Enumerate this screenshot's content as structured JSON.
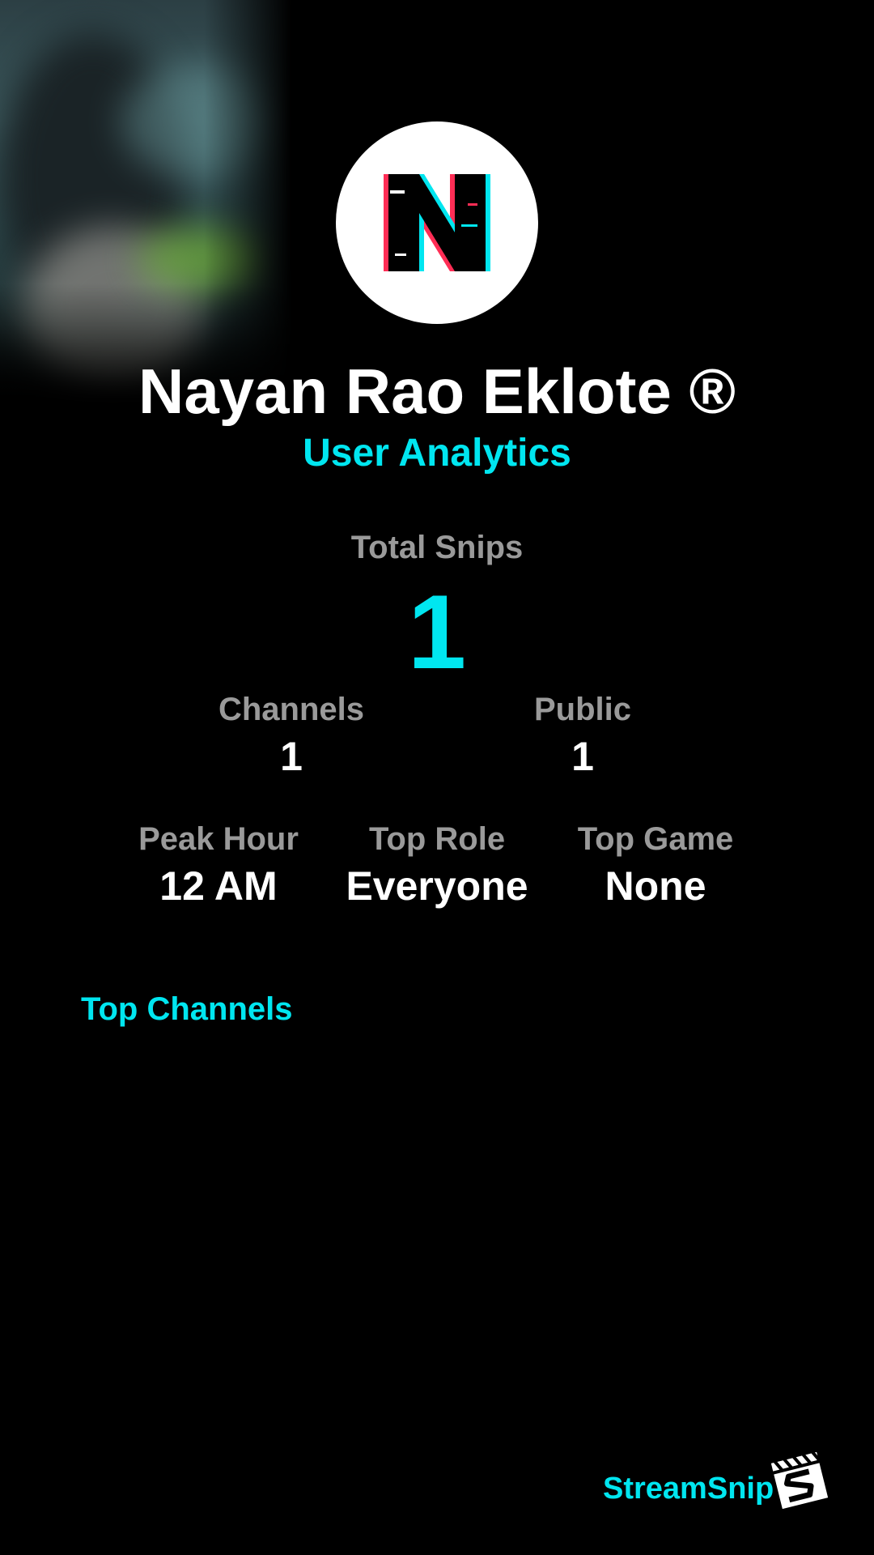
{
  "profile": {
    "name": "Nayan Rao Eklote ®",
    "subtitle": "User Analytics",
    "avatar_icon": "glitch-letter-n-logo"
  },
  "stats": {
    "total_snips": {
      "label": "Total Snips",
      "value": "1"
    },
    "channels": {
      "label": "Channels",
      "value": "1"
    },
    "public": {
      "label": "Public",
      "value": "1"
    },
    "peak_hour": {
      "label": "Peak Hour",
      "value": "12 AM"
    },
    "top_role": {
      "label": "Top Role",
      "value": "Everyone"
    },
    "top_game": {
      "label": "Top Game",
      "value": "None"
    }
  },
  "sections": {
    "top_channels": "Top Channels"
  },
  "branding": {
    "name": "StreamSnip",
    "logo_icon": "clapperboard-s-icon"
  },
  "colors": {
    "background": "#000000",
    "accent": "#00e6f0",
    "label": "#9a9a9a",
    "text": "#ffffff"
  }
}
